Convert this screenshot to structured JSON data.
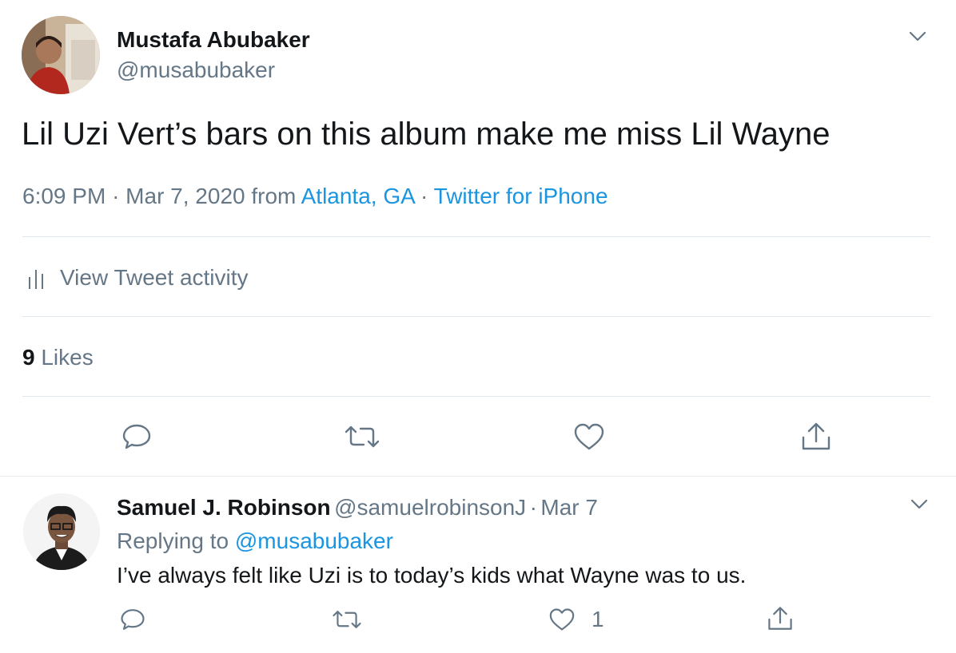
{
  "tweet": {
    "author_name": "Mustafa Abubaker",
    "author_handle": "@musabubaker",
    "text": "Lil Uzi Vert’s bars on this album make me miss Lil Wayne",
    "time": "6:09 PM",
    "date": "Mar 7, 2020",
    "from_label": "from",
    "location": "Atlanta, GA",
    "source": "Twitter for iPhone",
    "sep": "·",
    "activity_label": "View Tweet activity",
    "likes_count": "9",
    "likes_label": "Likes"
  },
  "reply": {
    "author_name": "Samuel J. Robinson",
    "author_handle": "@samuelrobinsonJ",
    "sep": "·",
    "date": "Mar 7",
    "replying_to_label": "Replying to",
    "replying_to_handle": "@musabubaker",
    "text": "I’ve always felt like Uzi is to today’s kids what Wayne was to us.",
    "like_count": "1"
  },
  "icons": {
    "reply": "reply-icon",
    "retweet": "retweet-icon",
    "like": "heart-icon",
    "share": "share-icon",
    "chevron": "chevron-down-icon",
    "activity": "bar-chart-icon"
  },
  "colors": {
    "link": "#1b95e0",
    "muted": "#657786",
    "text": "#14171a",
    "divider": "#e1e8ed"
  }
}
